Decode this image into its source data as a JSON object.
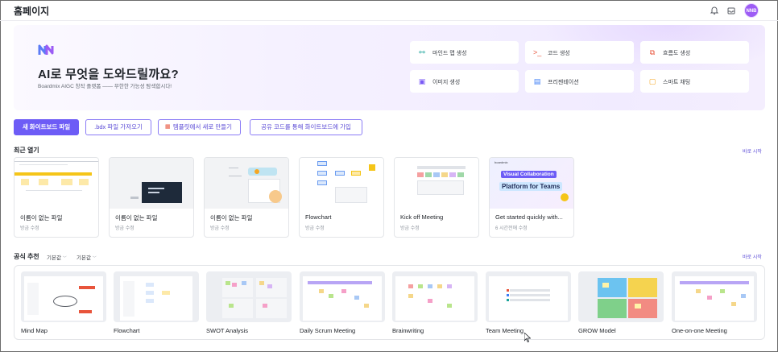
{
  "header": {
    "title": "홈페이지",
    "avatar_initials": "NNB"
  },
  "hero": {
    "title": "AI로 무엇을 도와드릴까요?",
    "subtitle": "Boardmix AIGC 창작 플랫폼 —— 무한한 가능성 탐색합시다!",
    "actions": [
      {
        "label": "마인드 맵 생성",
        "icon": "mindmap-icon",
        "color": "#1aa39a"
      },
      {
        "label": "코드 생성",
        "icon": "code-icon",
        "color": "#e8543b"
      },
      {
        "label": "흐름도 생성",
        "icon": "flowchart-icon",
        "color": "#e8543b"
      },
      {
        "label": "이미지 생성",
        "icon": "image-icon",
        "color": "#7a5af5"
      },
      {
        "label": "프리젠테이션",
        "icon": "presentation-icon",
        "color": "#3b7cf5"
      },
      {
        "label": "스마트 채팅",
        "icon": "chat-icon",
        "color": "#f5a623"
      }
    ]
  },
  "buttons": {
    "new_whiteboard": "새 화이트보드 파일",
    "import_bdx": ".bdx 파일 가져오기",
    "from_template": "템플릿에서 새로 만들기",
    "join_by_code": "공유 코드를 통해 화이트보드에 가입"
  },
  "recent": {
    "title": "최근 열기",
    "see_all": "바로 시작",
    "files": [
      {
        "name": "이름이 없는 파일",
        "meta": "방금 수정"
      },
      {
        "name": "이름이 없는 파일",
        "meta": "방금 수정"
      },
      {
        "name": "이름이 없는 파일",
        "meta": "방금 수정"
      },
      {
        "name": "Flowchart",
        "meta": "방금 수정"
      },
      {
        "name": "Kick off Meeting",
        "meta": "방금 수정"
      },
      {
        "name": "Get started quickly with...",
        "meta": "6 시간전에 수정"
      }
    ],
    "promo_text_1": "Visual Collaboration",
    "promo_text_2": "Platform for Teams",
    "promo_brand": "boardmix"
  },
  "recommended": {
    "title": "공식 추천",
    "filter_1": "기본값",
    "filter_2": "기본값",
    "see_all": "바로 시작",
    "templates": [
      {
        "name": "Mind Map"
      },
      {
        "name": "Flowchart"
      },
      {
        "name": "SWOT Analysis"
      },
      {
        "name": "Daily Scrum Meeting"
      },
      {
        "name": "Brainwriting"
      },
      {
        "name": "Team Meeting"
      },
      {
        "name": "GROW Model"
      },
      {
        "name": "One-on-one Meeting"
      }
    ]
  },
  "colors": {
    "accent": "#6d5cf6",
    "avatar": "#9d5cf5"
  }
}
